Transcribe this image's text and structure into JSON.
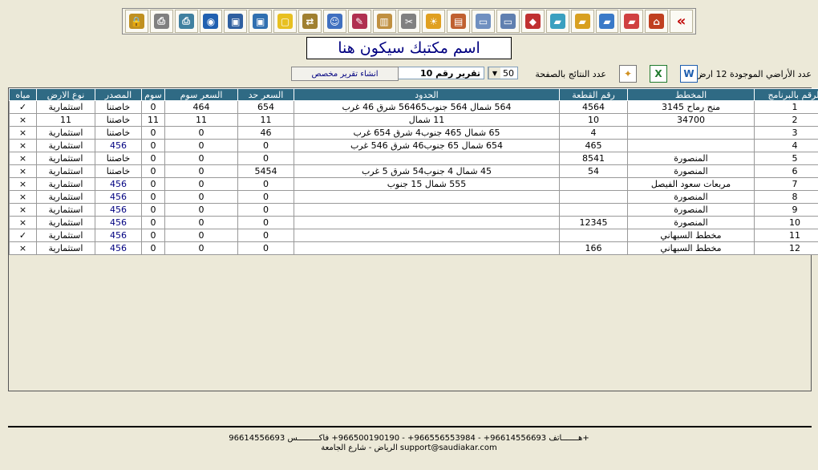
{
  "toolbar": {
    "buttons": [
      {
        "name": "back-arrows-icon",
        "glyph": "«",
        "color": "#C00000"
      },
      {
        "name": "home-icon",
        "glyph": "⌂",
        "color": "#C04020"
      },
      {
        "name": "red-folder-icon",
        "glyph": "▰",
        "color": "#D04040"
      },
      {
        "name": "blue-folder-icon",
        "glyph": "▰",
        "color": "#3A7AC8"
      },
      {
        "name": "yellow-folder-icon",
        "glyph": "▰",
        "color": "#D8A020"
      },
      {
        "name": "open-folder-icon",
        "glyph": "▰",
        "color": "#3AA0C0"
      },
      {
        "name": "cubes-icon",
        "glyph": "◆",
        "color": "#C03030"
      },
      {
        "name": "drive-upload-icon",
        "glyph": "▭",
        "color": "#6080B0"
      },
      {
        "name": "drive-icon",
        "glyph": "▭",
        "color": "#7090C0"
      },
      {
        "name": "document-home-icon",
        "glyph": "▤",
        "color": "#C06030"
      },
      {
        "name": "weather-icon",
        "glyph": "☀",
        "color": "#E0A020"
      },
      {
        "name": "tools-icon",
        "glyph": "✂",
        "color": "#808080"
      },
      {
        "name": "clipboard-icon",
        "glyph": "▥",
        "color": "#C09040"
      },
      {
        "name": "edit-document-icon",
        "glyph": "✎",
        "color": "#B03050"
      },
      {
        "name": "users-icon",
        "glyph": "☺",
        "color": "#4070C0"
      },
      {
        "name": "export-icon",
        "glyph": "⇄",
        "color": "#A08030"
      },
      {
        "name": "sticky-note-icon",
        "glyph": "▢",
        "color": "#E8C020"
      },
      {
        "name": "save-green-icon",
        "glyph": "▣",
        "color": "#3070B0"
      },
      {
        "name": "save-icon",
        "glyph": "▣",
        "color": "#3060A0"
      },
      {
        "name": "globe-icon",
        "glyph": "◉",
        "color": "#2060B0"
      },
      {
        "name": "scan-icon",
        "glyph": "⎙",
        "color": "#4080A0"
      },
      {
        "name": "print-icon",
        "glyph": "⎙",
        "color": "#808080"
      },
      {
        "name": "lock-icon",
        "glyph": "🔒",
        "color": "#C09020"
      }
    ]
  },
  "header": {
    "title": "اسم مكتبك سيكون هنا"
  },
  "controls": {
    "count_label": "عدد الأراضي الموجودة 12 ارض",
    "word_icon": "W",
    "excel_icon": "X",
    "per_page_label": "عدد النتائج بالصفحة",
    "per_page_value": "50",
    "report_value": "تقرير رقم 10",
    "custom_report_button": "انشاء تقرير مخصص"
  },
  "table": {
    "columns": [
      "الرقم بالبرنامج",
      "المخطط",
      "رقم القطعة",
      "الحدود",
      "السعر حد",
      "السعر سوم",
      "سوم",
      "المصدر",
      "نوع الارض",
      "مياه"
    ],
    "rows": [
      [
        "1",
        "منح رماح 3145",
        "4564",
        "564 شمال 564 جنوب56465 شرق 46 غرب",
        "654",
        "464",
        "0",
        "خاصتنا",
        "استثمارية",
        "✓"
      ],
      [
        "2",
        "34700",
        "10",
        "11 شمال",
        "11",
        "11",
        "11",
        "خاصتنا",
        "11",
        "×"
      ],
      [
        "3",
        "",
        "4",
        "65 شمال 465 جنوب4 شرق 654 غرب",
        "46",
        "0",
        "0",
        "خاصتنا",
        "استثمارية",
        "×"
      ],
      [
        "4",
        "",
        "465",
        "654 شمال 65 جنوب46 شرق 546 غرب",
        "0",
        "0",
        "0",
        "456",
        "استثمارية",
        "×"
      ],
      [
        "5",
        "المنصورة",
        "8541",
        "",
        "0",
        "0",
        "0",
        "خاصتنا",
        "استثمارية",
        "×"
      ],
      [
        "6",
        "المنصورة",
        "54",
        "45 شمال 4 جنوب54 شرق 5 غرب",
        "5454",
        "0",
        "0",
        "خاصتنا",
        "استثمارية",
        "×"
      ],
      [
        "7",
        "مربعات سعود الفيصل",
        "",
        "555 شمال 15 جنوب",
        "0",
        "0",
        "0",
        "456",
        "استثمارية",
        "×"
      ],
      [
        "8",
        "المنصورة",
        "",
        "",
        "0",
        "0",
        "0",
        "456",
        "استثمارية",
        "×"
      ],
      [
        "9",
        "المنصورة",
        "",
        "",
        "0",
        "0",
        "0",
        "456",
        "استثمارية",
        "×"
      ],
      [
        "10",
        "المنصورة",
        "12345",
        "",
        "0",
        "0",
        "0",
        "456",
        "استثمارية",
        "×"
      ],
      [
        "11",
        "مخطط السبهاني",
        "",
        "",
        "0",
        "0",
        "0",
        "456",
        "استثمارية",
        "✓"
      ],
      [
        "12",
        "مخطط السبهاني",
        "166",
        "",
        "0",
        "0",
        "0",
        "456",
        "استثمارية",
        "×"
      ]
    ]
  },
  "footer": {
    "line1": "هـــــــاتف 96614556693+ - 966556553984+ - 966500190190+ فاكـــــــــس 96614556693+",
    "line2": "الرياض - شارع الجامعة support@saudiakar.com"
  }
}
